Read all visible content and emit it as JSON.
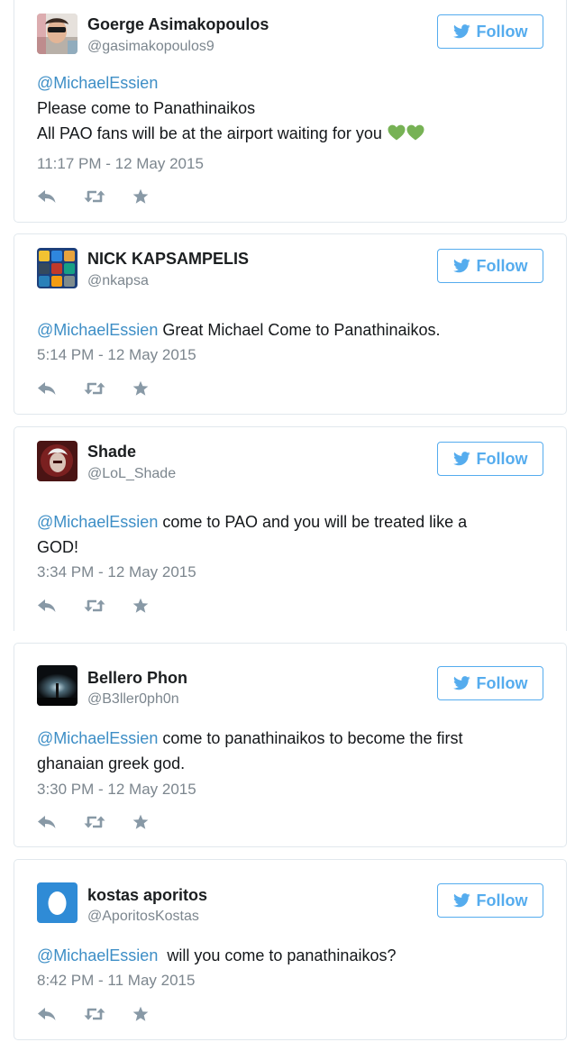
{
  "follow_label": "Follow",
  "accent_color": "#55acee",
  "icons": {
    "follow": "twitter-bird-icon",
    "reply": "reply-icon",
    "retweet": "retweet-icon",
    "favorite": "star-icon"
  },
  "tweets": [
    {
      "name": "Goerge Asimakopoulos",
      "handle": "@gasimakopoulos9",
      "mention": "@MichaelEssien",
      "text_lines": [
        "Please come to Panathinaikos",
        "All PAO fans will be at the airport  waiting for you"
      ],
      "emoji": "green-heart-icon ×2",
      "time": "11:17 PM - 12 May 2015"
    },
    {
      "name": "NICK KAPSAMPELIS",
      "handle": "@nkapsa",
      "mention": "@MichaelEssien",
      "text": " Great Michael Come to Panathinaikos.",
      "time": "5:14 PM - 12 May 2015"
    },
    {
      "name": "Shade",
      "handle": "@LoL_Shade",
      "mention": "@MichaelEssien",
      "text": " come to PAO and you will be treated like a GOD!",
      "time": "3:34 PM - 12 May 2015"
    },
    {
      "name": "Bellero Phon",
      "handle": "@B3ller0ph0n",
      "mention": "@MichaelEssien",
      "text": " come to panathinaikos to become the first ghanaian greek god.",
      "time": "3:30 PM - 12 May 2015"
    },
    {
      "name": "kostas aporitos",
      "handle": "@AporitosKostas",
      "mention": "@MichaelEssien",
      "text": "  will you come to panathinaikos?",
      "time": "8:42 PM - 11 May 2015"
    }
  ]
}
